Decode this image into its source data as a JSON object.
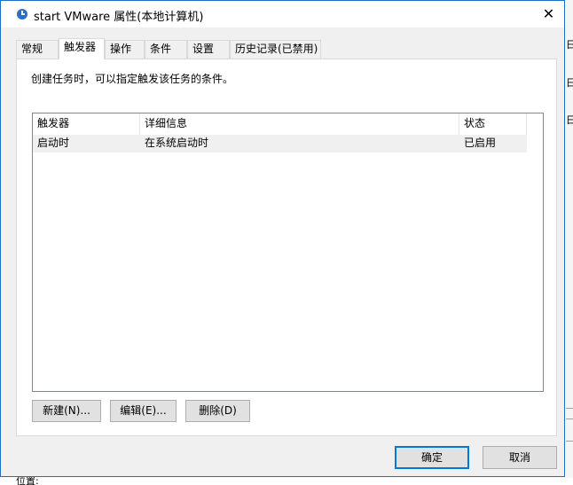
{
  "background": {
    "right_glyphs": [
      "日",
      "日",
      "日"
    ],
    "bottom_text": "位置:"
  },
  "window": {
    "title": "start VMware 属性(本地计算机)",
    "close_glyph": "✕"
  },
  "tabs": [
    {
      "label": "常规",
      "active": false
    },
    {
      "label": "触发器",
      "active": true
    },
    {
      "label": "操作",
      "active": false
    },
    {
      "label": "条件",
      "active": false
    },
    {
      "label": "设置",
      "active": false
    },
    {
      "label": "历史记录(已禁用)",
      "active": false
    }
  ],
  "panel": {
    "instruction": "创建任务时，可以指定触发该任务的条件。",
    "table": {
      "columns": [
        "触发器",
        "详细信息",
        "状态"
      ],
      "rows": [
        {
          "trigger": "启动时",
          "details": "在系统启动时",
          "status": "已启用"
        }
      ]
    },
    "buttons": {
      "new": "新建(N)...",
      "edit": "编辑(E)...",
      "delete": "删除(D)"
    }
  },
  "footer": {
    "ok": "确定",
    "cancel": "取消"
  }
}
